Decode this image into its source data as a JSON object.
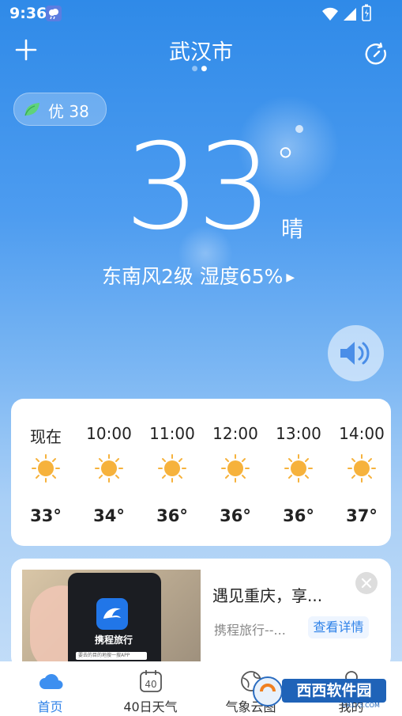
{
  "status_bar": {
    "time": "9:36"
  },
  "header": {
    "city": "武汉市",
    "page_dots": "• •"
  },
  "air_quality": {
    "label": "优 38"
  },
  "current": {
    "temperature": "33",
    "degree_symbol": "°",
    "condition": "晴",
    "wind_humidity": "东南风2级 湿度65%"
  },
  "hourly": [
    {
      "time": "现在",
      "temp": "33°"
    },
    {
      "time": "10:00",
      "temp": "34°"
    },
    {
      "time": "11:00",
      "temp": "36°"
    },
    {
      "time": "12:00",
      "temp": "36°"
    },
    {
      "time": "13:00",
      "temp": "36°"
    },
    {
      "time": "14:00",
      "temp": "37°"
    }
  ],
  "ad": {
    "title": "遇见重庆，享...",
    "source": "携程旅行--...",
    "button": "查看详情",
    "image_brand": "携程旅行",
    "image_search": "要去的目的地搜一搜APP"
  },
  "bottom_nav": [
    {
      "label": "首页",
      "active": true
    },
    {
      "label": "40日天气",
      "calendar_number": "40"
    },
    {
      "label": "气象云图"
    },
    {
      "label": "我的"
    }
  ],
  "watermark": {
    "text": "西西软件园",
    "sub": "CR173.COM"
  },
  "colors": {
    "accent": "#2f82e8",
    "sun": "#f6b23c"
  }
}
